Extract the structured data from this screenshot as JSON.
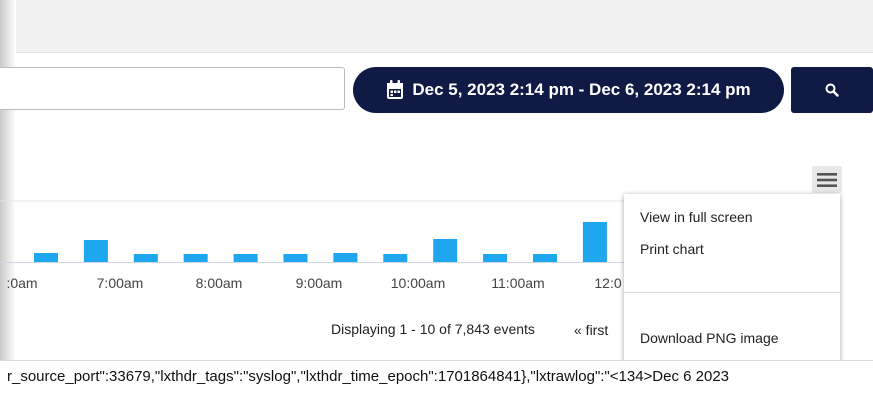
{
  "header": {
    "date_range": "Dec 5, 2023 2:14 pm - Dec 6, 2023 2:14 pm"
  },
  "icons": {
    "calendar": "calendar-icon",
    "search": "search-icon",
    "menu": "hamburger-menu-icon"
  },
  "colors": {
    "navy": "#0f1a45",
    "bar": "#1ea7ee"
  },
  "chart_data": {
    "type": "bar",
    "x_tick_labels": [
      ":0am",
      "7:00am",
      "8:00am",
      "9:00am",
      "10:00am",
      "11:00am",
      "12:0"
    ],
    "values": [
      9,
      22,
      8,
      8,
      8,
      8,
      9,
      8,
      23,
      8,
      8,
      40
    ],
    "grid": true
  },
  "chart_menu": {
    "items": [
      "View in full screen",
      "Print chart",
      "Download PNG image"
    ]
  },
  "pagination": {
    "summary": "Displaying 1 - 10 of 7,843 events",
    "first": "« first"
  },
  "log": {
    "line": "r_source_port\":33679,\"lxthdr_tags\":\"syslog\",\"lxthdr_time_epoch\":1701864841},\"lxtrawlog\":\"<134>Dec 6 2023"
  }
}
